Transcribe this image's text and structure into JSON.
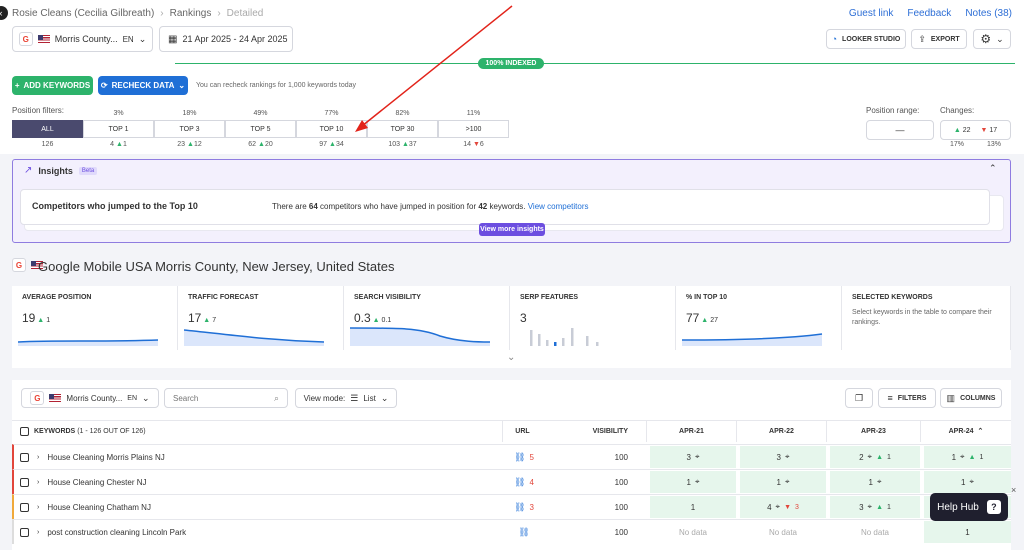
{
  "breadcrumb": {
    "client": "Rosie Cleans (Cecilia Gilbreath)",
    "section": "Rankings",
    "page": "Detailed"
  },
  "toplinks": {
    "guest": "Guest link",
    "feedback": "Feedback",
    "notes": "Notes (38)"
  },
  "location": {
    "name": "Morris County...",
    "lang": "EN"
  },
  "date_range": "21 Apr 2025 - 24 Apr 2025",
  "buttons": {
    "looker": "LOOKER STUDIO",
    "export": "EXPORT",
    "add_keywords": "ADD KEYWORDS",
    "recheck": "RECHECK DATA",
    "recheck_note": "You can recheck rankings for 1,000 keywords today"
  },
  "indexed": "100% INDEXED",
  "position_filters": {
    "label": "Position filters:",
    "segments": [
      {
        "label": "ALL",
        "pct": "",
        "count": "126",
        "delta": "",
        "dir": ""
      },
      {
        "label": "TOP 1",
        "pct": "3%",
        "count": "4",
        "delta": "1",
        "dir": "up"
      },
      {
        "label": "TOP 3",
        "pct": "18%",
        "count": "23",
        "delta": "12",
        "dir": "up"
      },
      {
        "label": "TOP 5",
        "pct": "49%",
        "count": "62",
        "delta": "20",
        "dir": "up"
      },
      {
        "label": "TOP 10",
        "pct": "77%",
        "count": "97",
        "delta": "34",
        "dir": "up"
      },
      {
        "label": "TOP 30",
        "pct": "82%",
        "count": "103",
        "delta": "37",
        "dir": "up"
      },
      {
        "label": ">100",
        "pct": "11%",
        "count": "14",
        "delta": "6",
        "dir": "down"
      }
    ]
  },
  "position_range": {
    "label": "Position range:",
    "value": "—"
  },
  "changes": {
    "label": "Changes:",
    "up": "22",
    "down": "17",
    "up_pct": "17%",
    "down_pct": "13%"
  },
  "insights": {
    "title": "Insights",
    "beta": "Beta",
    "card_title": "Competitors who jumped to the Top 10",
    "card_text_pre": "There are ",
    "competitors": "64",
    "card_text_mid": " competitors who have jumped in position for ",
    "keywords": "42",
    "card_text_post": " keywords.",
    "card_link": "View competitors",
    "view_more": "View more insights"
  },
  "engine_title": "Google Mobile USA Morris County, New Jersey, United States",
  "metrics": [
    {
      "label": "AVERAGE POSITION",
      "value": "19",
      "delta": "1"
    },
    {
      "label": "TRAFFIC FORECAST",
      "value": "17",
      "delta": "7"
    },
    {
      "label": "SEARCH VISIBILITY",
      "value": "0.3",
      "delta": "0.1"
    },
    {
      "label": "SERP FEATURES",
      "value": "3",
      "delta": ""
    },
    {
      "label": "% IN TOP 10",
      "value": "77",
      "delta": "27"
    },
    {
      "label": "SELECTED KEYWORDS",
      "value": "",
      "delta": "",
      "desc": "Select keywords in the table to compare their rankings."
    }
  ],
  "table_toolbar": {
    "location": "Morris County...",
    "lang": "EN",
    "search_placeholder": "Search",
    "view_mode_label": "View mode:",
    "view_mode": "List",
    "filters": "FILTERS",
    "columns": "COLUMNS"
  },
  "table": {
    "headers": {
      "keywords": "KEYWORDS",
      "keywords_count": "(1 - 126 OUT OF 126)",
      "url": "URL",
      "visibility": "VISIBILITY",
      "d1": "APR-21",
      "d2": "APR-22",
      "d3": "APR-23",
      "d4": "APR-24"
    },
    "rows": [
      {
        "kw": "House Cleaning Morris Plains NJ",
        "url_count": "5",
        "vis": "100",
        "d1": "3",
        "d2": "3",
        "d3": "2",
        "d3d": "1",
        "d4": "1",
        "d4d": "1"
      },
      {
        "kw": "House Cleaning Chester NJ",
        "url_count": "4",
        "vis": "100",
        "d1": "1",
        "d2": "1",
        "d3": "1",
        "d3d": "",
        "d4": "1",
        "d4d": ""
      },
      {
        "kw": "House Cleaning Chatham NJ",
        "url_count": "3",
        "vis": "100",
        "d1": "1",
        "d2": "4",
        "d2d": "3",
        "d3": "3",
        "d3d": "1",
        "d4": "1",
        "d4d": ""
      },
      {
        "kw": "post construction cleaning Lincoln Park",
        "url_count": "",
        "vis": "100",
        "d1": "No data",
        "d2": "No data",
        "d3": "No data",
        "d4": "1",
        "d4d": ""
      }
    ]
  },
  "helphub": "Help Hub"
}
